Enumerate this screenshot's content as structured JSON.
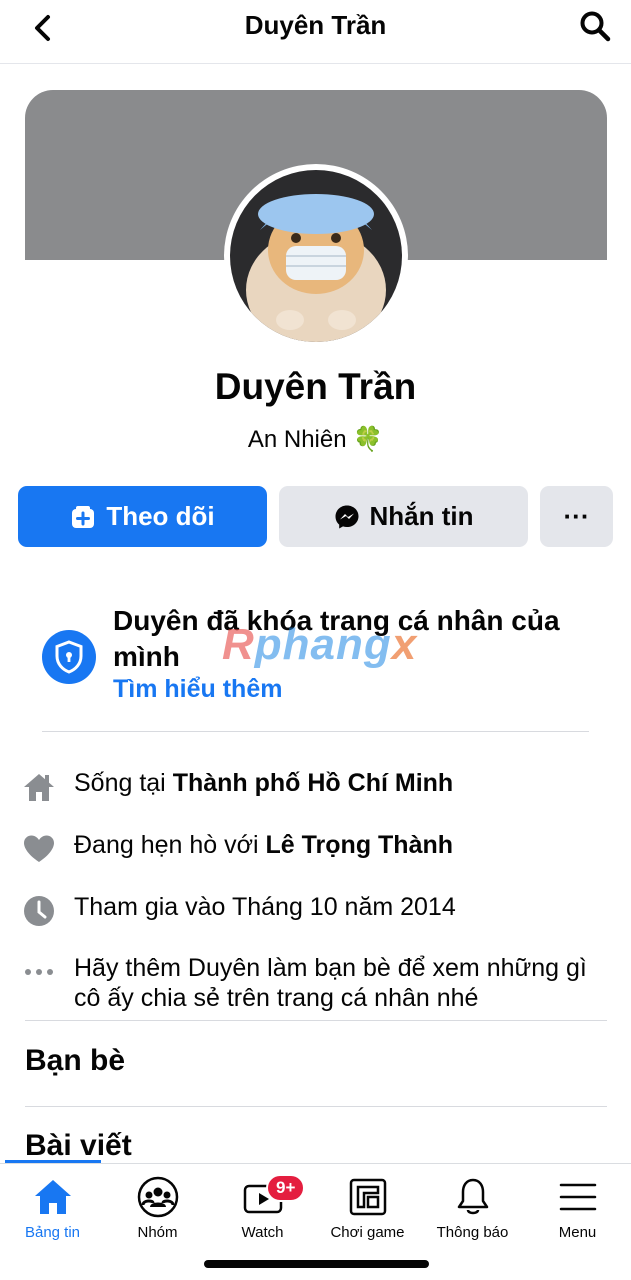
{
  "header": {
    "title": "Duyên Trần",
    "back_icon": "chevron-left-icon",
    "search_icon": "search-icon"
  },
  "profile": {
    "name": "Duyên Trần",
    "bio": "An Nhiên",
    "bio_emoji": "🍀",
    "cover_color": "#8a8b8d"
  },
  "actions": {
    "follow_label": "Theo dõi",
    "message_label": "Nhắn tin",
    "more_label": "···"
  },
  "lock_notice": {
    "title": "Duyên đã khóa trang cá nhân của mình",
    "link": "Tìm hiểu thêm"
  },
  "watermark": {
    "part1": "R",
    "part2": "phang",
    "part3": "x"
  },
  "info": {
    "lives_prefix": "Sống tại ",
    "lives_value": "Thành phố Hồ Chí Minh",
    "dating_prefix": "Đang hẹn hò với ",
    "dating_value": "Lê Trọng Thành",
    "joined": "Tham gia vào Tháng 10 năm 2014",
    "add_friend_hint": "Hãy thêm Duyên làm bạn bè để xem những gì cô ấy chia sẻ trên trang cá nhân nhé"
  },
  "sections": {
    "friends": "Bạn bè",
    "posts": "Bài viết"
  },
  "tabbar": {
    "items": [
      {
        "label": "Bảng tin",
        "icon": "home-icon"
      },
      {
        "label": "Nhóm",
        "icon": "groups-icon"
      },
      {
        "label": "Watch",
        "icon": "watch-icon"
      },
      {
        "label": "Chơi game",
        "icon": "gaming-icon"
      },
      {
        "label": "Thông báo",
        "icon": "bell-icon"
      },
      {
        "label": "Menu",
        "icon": "menu-icon"
      }
    ],
    "watch_badge": "9+"
  },
  "colors": {
    "accent": "#1877f2",
    "badge": "#e41e3f"
  }
}
